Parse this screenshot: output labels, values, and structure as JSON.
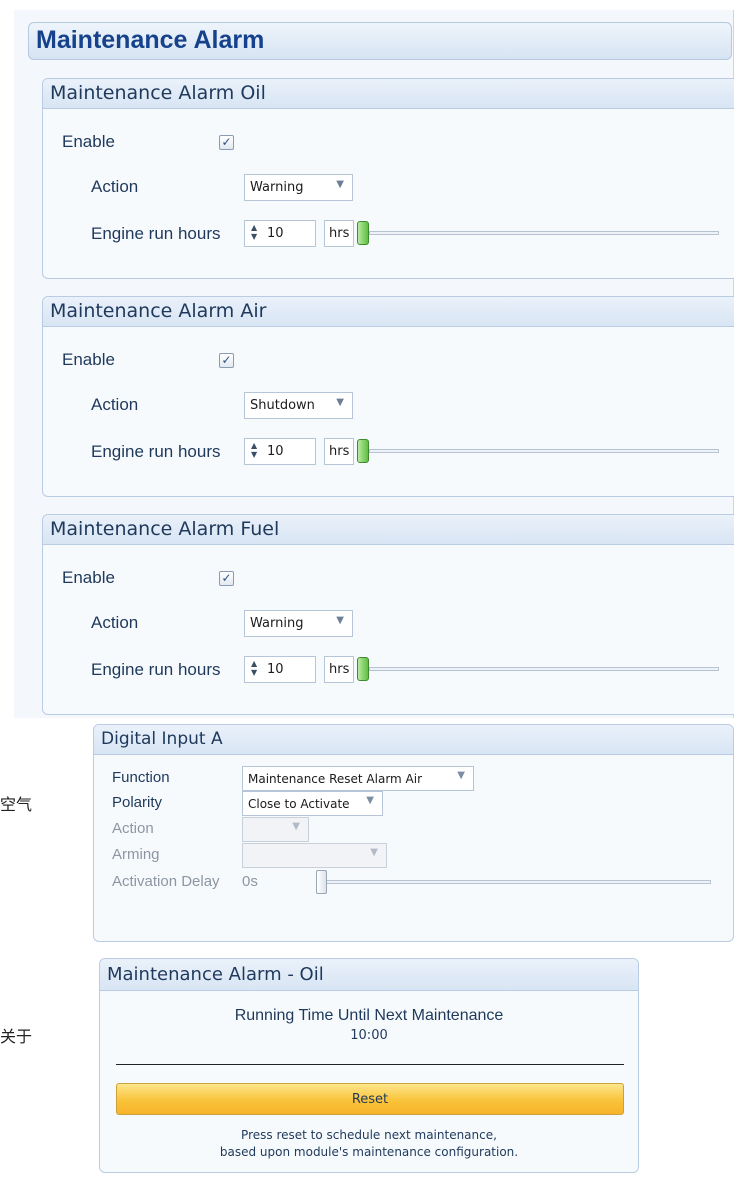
{
  "main": {
    "title": "Maintenance Alarm",
    "groups": [
      {
        "header": "Maintenance Alarm Oil",
        "enable_label": "Enable",
        "enabled": true,
        "action_label": "Action",
        "action_value": "Warning",
        "hours_label": "Engine run hours",
        "hours_value": "10",
        "hours_unit": "hrs"
      },
      {
        "header": "Maintenance Alarm Air",
        "enable_label": "Enable",
        "enabled": true,
        "action_label": "Action",
        "action_value": "Shutdown",
        "hours_label": "Engine run hours",
        "hours_value": "10",
        "hours_unit": "hrs"
      },
      {
        "header": "Maintenance Alarm Fuel",
        "enable_label": "Enable",
        "enabled": true,
        "action_label": "Action",
        "action_value": "Warning",
        "hours_label": "Engine run hours",
        "hours_value": "10",
        "hours_unit": "hrs"
      }
    ],
    "checkbox_glyph": "✓",
    "spin_glyph_up": "▲",
    "spin_glyph_down": "▼",
    "dropdown_glyph": "▼"
  },
  "digital_input": {
    "header": "Digital Input A",
    "function_label": "Function",
    "function_value": "Maintenance Reset Alarm Air",
    "polarity_label": "Polarity",
    "polarity_value": "Close to Activate",
    "action_label": "Action",
    "action_value": "",
    "arming_label": "Arming",
    "arming_value": "",
    "delay_label": "Activation Delay",
    "delay_value": "0s"
  },
  "side_notes": {
    "note_1": "空气",
    "note_2": "关于"
  },
  "maintenance_panel": {
    "header": "Maintenance Alarm - Oil",
    "running_title": "Running Time Until Next Maintenance",
    "running_value": "10:00",
    "reset_label": "Reset",
    "hint_line_1": "Press reset to schedule next maintenance,",
    "hint_line_2": "based upon module's maintenance configuration."
  },
  "colors": {
    "accent_text": "#15428b",
    "slider_thumb": "#5fbf3e",
    "reset_button": "#f9c33a"
  }
}
